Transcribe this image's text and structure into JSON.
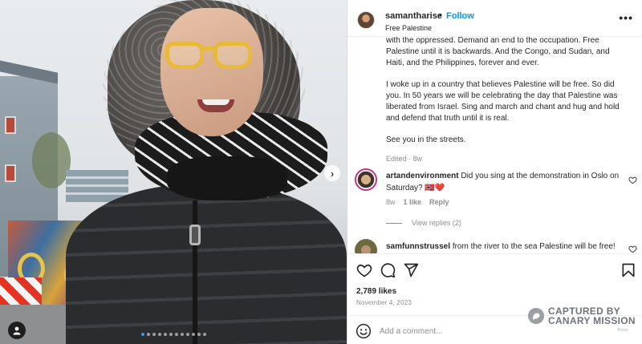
{
  "post": {
    "username": "samantharise",
    "follow_label": "Follow",
    "separator": "•",
    "subtitle": "Free Palestine",
    "more_label": "•••"
  },
  "caption": {
    "paragraph1": "with the oppressed. Demand an end to the occupation. Free Palestine until it is backwards. And the Congo, and Sudan, and Haiti, and the Philippines, forever and ever.",
    "paragraph2": "I woke up in a country that believes Palestine will be free. So did you. In 50 years we will be celebrating the day that Palestine was liberated from Israel. Sing and march and chant and hug and hold and defend that truth until it is real.",
    "paragraph3": "See you in the streets.",
    "edited": "Edited · 8w"
  },
  "comments": [
    {
      "username": "artandenvironment",
      "text": "Did you sing at the demonstration in Oslo on Saturday? 🇳🇴❤️",
      "age": "8w",
      "likes": "1 like",
      "reply_label": "Reply",
      "view_replies": "View replies (2)"
    },
    {
      "username": "samfunnstrussel",
      "text": "from the river to the sea Palestine will be free!"
    }
  ],
  "engagement": {
    "likes": "2,789 likes",
    "date": "November 4, 2023"
  },
  "comment_box": {
    "placeholder": "Add a comment..."
  },
  "carousel": {
    "slide_count": 12,
    "current_slide": 1
  },
  "watermark": {
    "line1": "CAPTURED BY",
    "line2": "CANARY MISSION",
    "small": "Posts"
  },
  "colors": {
    "accent": "#0095f6",
    "text": "#262626",
    "muted": "#8e8e8e",
    "like_red": "#ed4956"
  }
}
